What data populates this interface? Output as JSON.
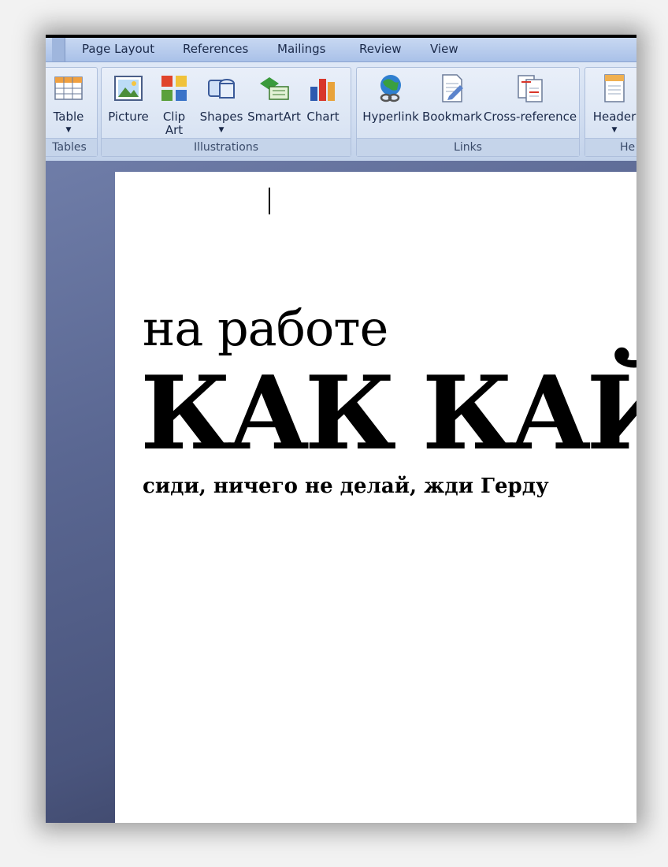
{
  "tabs": [
    "Page Layout",
    "References",
    "Mailings",
    "Review",
    "View"
  ],
  "groups": {
    "tables": {
      "label": "Tables",
      "buttons": [
        {
          "label": "Table",
          "icon": "table-icon",
          "has_arrow": true
        }
      ]
    },
    "illustrations": {
      "label": "Illustrations",
      "buttons": [
        {
          "label": "Picture",
          "icon": "picture-icon"
        },
        {
          "label": "Clip Art",
          "label_line2": "Art",
          "label_line1": "Clip",
          "icon": "clip-art-icon"
        },
        {
          "label": "Shapes",
          "icon": "shapes-icon",
          "has_arrow": true
        },
        {
          "label": "SmartArt",
          "icon": "smartart-icon"
        },
        {
          "label": "Chart",
          "icon": "chart-icon"
        }
      ]
    },
    "links": {
      "label": "Links",
      "buttons": [
        {
          "label": "Hyperlink",
          "icon": "hyperlink-icon"
        },
        {
          "label": "Bookmark",
          "icon": "bookmark-icon"
        },
        {
          "label": "Cross-reference",
          "icon": "cross-reference-icon"
        }
      ]
    },
    "header_footer": {
      "label": "He",
      "buttons": [
        {
          "label": "Header",
          "icon": "header-icon",
          "has_arrow": true
        }
      ]
    }
  },
  "document": {
    "line1": "на работе",
    "line2": "КАК КАЙ",
    "line3": "сиди, ничего не делай, жди Герду"
  },
  "colors": {
    "ribbon": "#dfe8f6",
    "tab_bar": "#b7cbed",
    "workspace": "#5a6792",
    "page": "#ffffff"
  }
}
